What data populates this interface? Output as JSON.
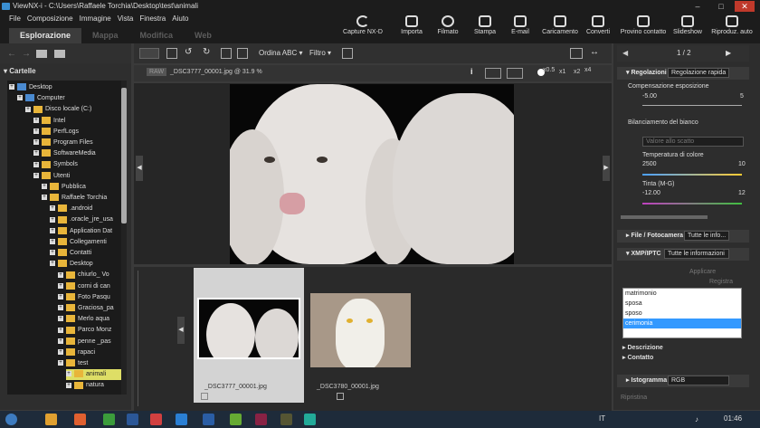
{
  "window": {
    "title": "ViewNX-i - C:\\Users\\Raffaele Torchia\\Desktop\\test\\animali",
    "min": "–",
    "max": "□",
    "close": "✕"
  },
  "menu": [
    "File",
    "Composizione",
    "Immagine",
    "Vista",
    "Finestra",
    "Aiuto"
  ],
  "tabs": [
    "Esplorazione",
    "Mappa",
    "Modifica",
    "Web"
  ],
  "toolbar": [
    "Capture NX-D",
    "Importa",
    "Filmato",
    "Stampa",
    "E-mail",
    "Caricamento",
    "Converti",
    "Provino contatto",
    "Slideshow",
    "Riproduz. auto"
  ],
  "left": {
    "cartelle": "Cartelle",
    "tree": [
      {
        "label": "Desktop",
        "indent": 0
      },
      {
        "label": "Computer",
        "indent": 1
      },
      {
        "label": "Disco locale (C:)",
        "indent": 2
      },
      {
        "label": "Intel",
        "indent": 3
      },
      {
        "label": "PerfLogs",
        "indent": 3
      },
      {
        "label": "Program Files",
        "indent": 3
      },
      {
        "label": "SoftwareMedia",
        "indent": 3
      },
      {
        "label": "Symbols",
        "indent": 3
      },
      {
        "label": "Utenti",
        "indent": 3
      },
      {
        "label": "Pubblica",
        "indent": 4
      },
      {
        "label": "Raffaele Torchia",
        "indent": 4
      },
      {
        "label": ".android",
        "indent": 5
      },
      {
        "label": ".oracle_jre_usa",
        "indent": 5
      },
      {
        "label": "Application Dat",
        "indent": 5
      },
      {
        "label": "Collegamenti",
        "indent": 5
      },
      {
        "label": "Contatti",
        "indent": 5
      },
      {
        "label": "Desktop",
        "indent": 5
      },
      {
        "label": "chiurlo_ Vo",
        "indent": 6
      },
      {
        "label": "corni di can",
        "indent": 6
      },
      {
        "label": "Foto Pasqu",
        "indent": 6
      },
      {
        "label": "Graciosa_pa",
        "indent": 6
      },
      {
        "label": "Merlo aqua",
        "indent": 6
      },
      {
        "label": "Parco Monz",
        "indent": 6
      },
      {
        "label": "penne _pas",
        "indent": 6
      },
      {
        "label": "rapaci",
        "indent": 6
      },
      {
        "label": "test",
        "indent": 6
      },
      {
        "label": "animali",
        "indent": 7,
        "selected": true
      },
      {
        "label": "natura",
        "indent": 7
      }
    ],
    "counter": "0"
  },
  "center": {
    "order": "Ordina ABC ▾",
    "filter": "Filtro ▾",
    "raw": "RAW",
    "filename": "_DSC3777_00001.jpg @ 31.9 %",
    "zoom": [
      "x0.5",
      "x1",
      "x2",
      "x4"
    ],
    "thumbs": [
      {
        "name": "_DSC3777_00001.jpg",
        "selected": true
      },
      {
        "name": "_DSC3780_00001.jpg",
        "selected": false
      }
    ]
  },
  "right": {
    "pager": "1 / 2",
    "regolazioni": "Regolazioni",
    "regolazione_rapida": "Regolazione rapida",
    "comp_esposizione": "Compensazione esposizione",
    "comp_min": "-5.00",
    "comp_max": "5",
    "bilanciamento": "Bilanciamento del bianco",
    "valore_scatto": "Valore allo scatto",
    "temperatura": "Temperatura di colore",
    "temp_min": "2500",
    "temp_max": "10",
    "tinta": "Tinta (M-G)",
    "tinta_min": "-12.00",
    "tinta_max": "12",
    "file_fotocamera": "File / Fotocamera",
    "tutte_info": "Tutte le info...",
    "xmp": "XMP/IPTC",
    "tutte_informazioni": "Tutte le informazioni",
    "applicare": "Applicare",
    "registra": "Registra",
    "keywords": [
      "matrimonio",
      "sposa",
      "sposo",
      "cerimonia"
    ],
    "descrizione": "Descrizione",
    "contatto": "Contatto",
    "istogramma": "Istogramma",
    "rgb": "RGB",
    "ripristina": "Ripristina"
  },
  "taskbar": {
    "lang": "IT",
    "time": "01:46"
  }
}
